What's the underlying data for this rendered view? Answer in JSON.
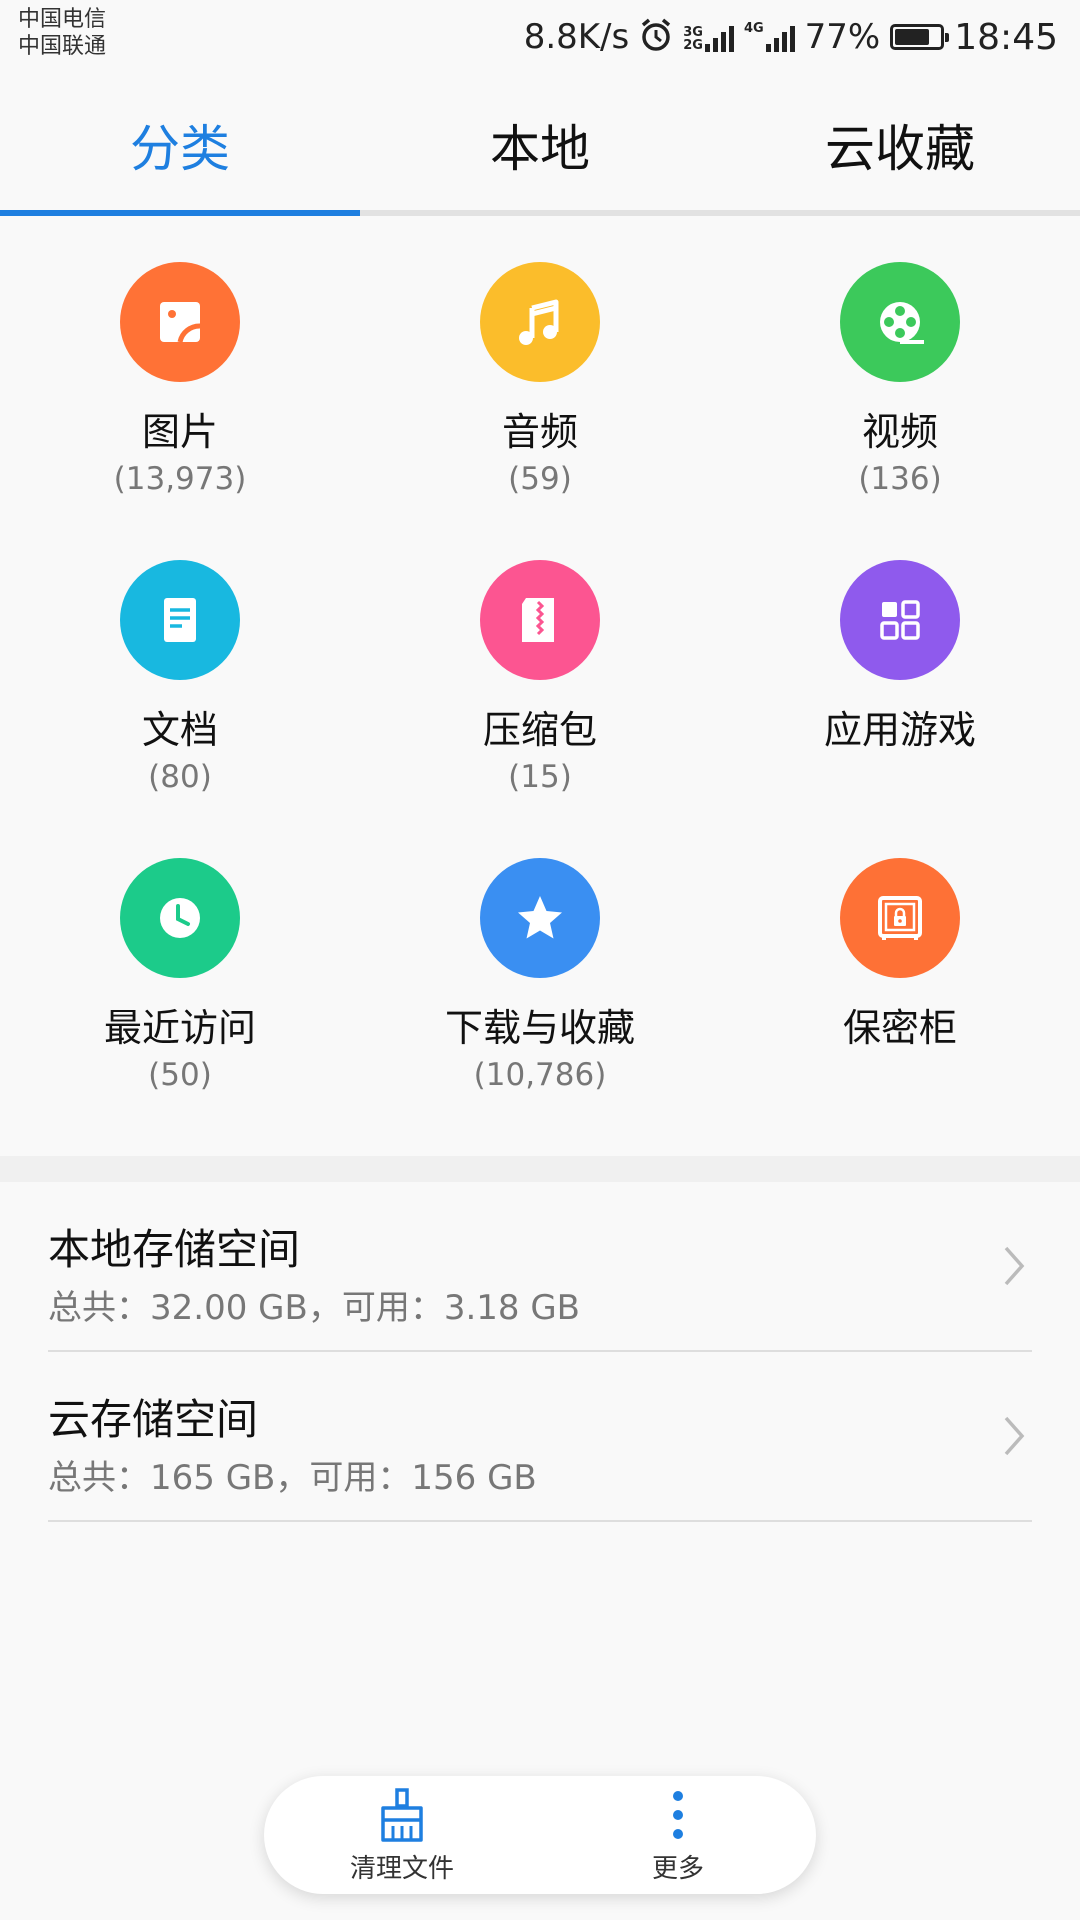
{
  "status_bar": {
    "carriers": [
      "中国电信",
      "中国联通"
    ],
    "net_speed": "8.8K/s",
    "signal1_tag": [
      "3G",
      "2G"
    ],
    "signal2_tag": "4G",
    "battery_percent": "77%",
    "battery_level": 0.77,
    "time": "18:45"
  },
  "tabs": {
    "items": [
      {
        "label": "分类"
      },
      {
        "label": "本地"
      },
      {
        "label": "云收藏"
      }
    ],
    "active_index": 0
  },
  "categories": [
    {
      "label": "图片",
      "count": "(13,973)",
      "icon": "image-icon",
      "color": "#ff7236"
    },
    {
      "label": "音频",
      "count": "(59)",
      "icon": "music-note-icon",
      "color": "#fbbd2b"
    },
    {
      "label": "视频",
      "count": "(136)",
      "icon": "film-reel-icon",
      "color": "#3cc95b"
    },
    {
      "label": "文档",
      "count": "(80)",
      "icon": "document-icon",
      "color": "#18b8e0"
    },
    {
      "label": "压缩包",
      "count": "(15)",
      "icon": "zip-icon",
      "color": "#fc5591"
    },
    {
      "label": "应用游戏",
      "count": "",
      "icon": "apps-grid-icon",
      "color": "#8f5aed"
    },
    {
      "label": "最近访问",
      "count": "(50)",
      "icon": "clock-icon",
      "color": "#1ccb8a"
    },
    {
      "label": "下载与收藏",
      "count": "(10,786)",
      "icon": "star-icon",
      "color": "#3a8ff2"
    },
    {
      "label": "保密柜",
      "count": "",
      "icon": "safe-icon",
      "color": "#fe7136"
    }
  ],
  "storage": {
    "local": {
      "title": "本地存储空间",
      "detail": "总共：32.00 GB，可用：3.18 GB"
    },
    "cloud": {
      "title": "云存储空间",
      "detail": "总共：165 GB，可用：156 GB"
    }
  },
  "bottom_actions": {
    "clean": {
      "label": "清理文件",
      "icon": "broom-icon"
    },
    "more": {
      "label": "更多",
      "icon": "more-vertical-icon"
    }
  },
  "colors": {
    "accent": "#1e7fe0"
  }
}
